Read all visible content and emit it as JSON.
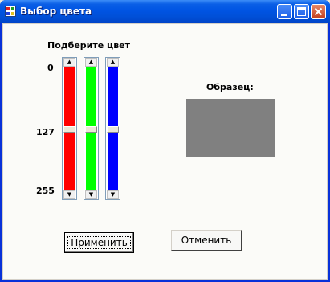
{
  "window": {
    "title": "Выбор цвета"
  },
  "picker": {
    "heading": "Подберите цвет",
    "scale": {
      "top": "0",
      "middle": "127",
      "bottom": "255"
    },
    "sliders": [
      {
        "channel": "red",
        "value": 127,
        "color": "#ff0000"
      },
      {
        "channel": "green",
        "value": 127,
        "color": "#00ff00"
      },
      {
        "channel": "blue",
        "value": 127,
        "color": "#0000ff"
      }
    ]
  },
  "sample": {
    "label": "Образец:",
    "color": "#808080"
  },
  "buttons": {
    "apply": "Применить",
    "cancel": "Отменить"
  },
  "icons": {
    "app": "color-picker-icon",
    "minimize": "minimize-icon",
    "maximize": "maximize-icon",
    "close": "close-icon"
  }
}
